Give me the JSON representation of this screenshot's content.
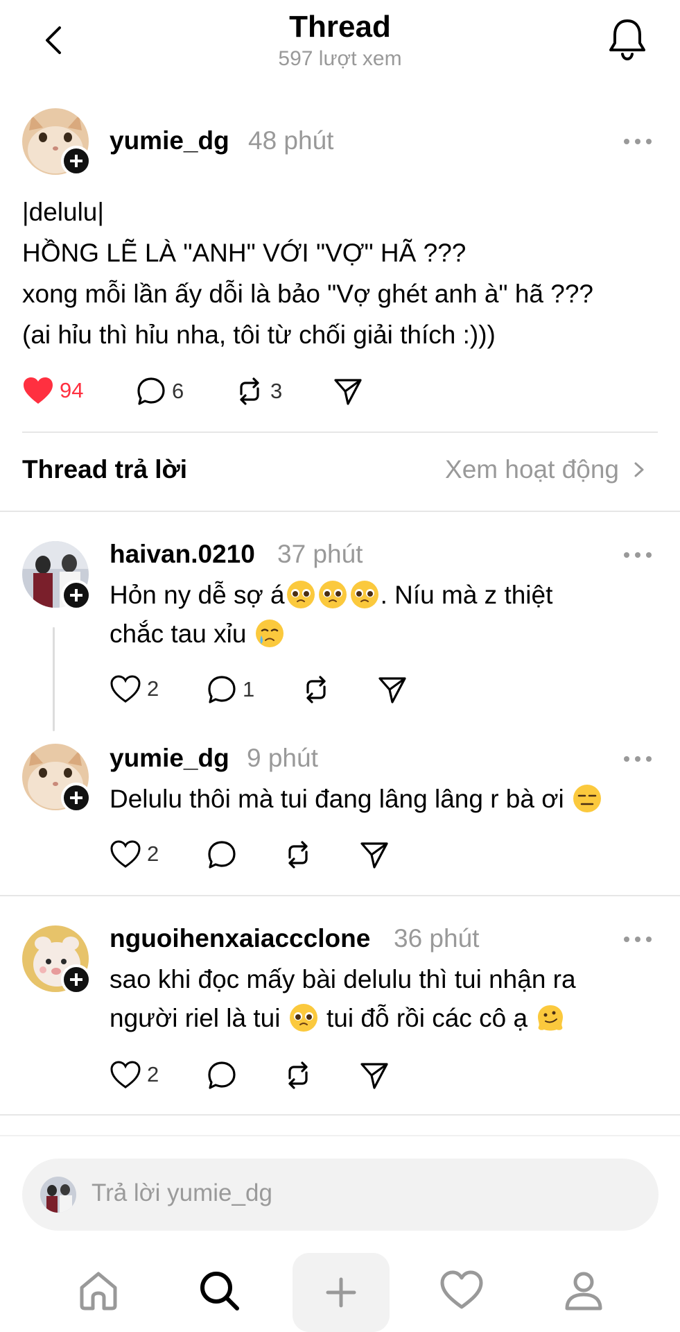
{
  "header": {
    "title": "Thread",
    "subtitle": "597 lượt xem"
  },
  "post": {
    "username": "yumie_dg",
    "time": "48 phút",
    "lines": [
      "|delulu|",
      "HỒNG LẼ LÀ \"ANH\" VỚI \"VỢ\" HÃ ???",
      "xong mỗi lần ấy dỗi là bảo \"Vợ ghét anh à\" hã ???",
      "(ai hỉu thì hỉu nha, tôi từ chối giải thích :)))"
    ],
    "likes": "94",
    "comments": "6",
    "reposts": "3"
  },
  "section": {
    "title": "Thread trả lời",
    "link": "Xem hoạt động"
  },
  "replies": [
    {
      "username": "haivan.0210",
      "time": "37 phút",
      "line1": "Hỏn ny dễ sợ á",
      "line1_end": ". Níu mà z thiệt",
      "line2": "chắc tau xỉu",
      "likes": "2",
      "comments": "1"
    },
    {
      "username": "yumie_dg",
      "time": "9 phút",
      "line1": "Delulu thôi mà tui đang lâng lâng r bà ơi",
      "likes": "2"
    },
    {
      "username": "nguoihenxaiaccclone",
      "time": "36 phút",
      "line1": "sao khi đọc mấy bài delulu thì tui nhận ra",
      "line2a": "người riel là tui",
      "line2b": "tui đỗ rồi các cô ạ",
      "likes": "2"
    }
  ],
  "reply_box": {
    "placeholder": "Trả lời yumie_dg"
  },
  "colors": {
    "like_red": "#ff3040",
    "muted": "#999999",
    "divider": "#e6e6e6"
  },
  "icons": [
    "back-icon",
    "bell-icon",
    "heart-icon",
    "comment-icon",
    "repost-icon",
    "share-icon",
    "more-icon",
    "chevron-right-icon",
    "home-icon",
    "search-icon",
    "plus-icon",
    "activity-icon",
    "profile-icon"
  ]
}
